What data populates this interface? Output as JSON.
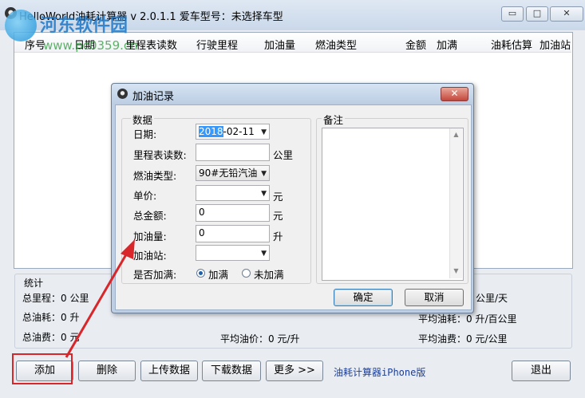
{
  "main": {
    "title": "HelloWorld油耗计算器 v 2.0.1.1   爱车型号：未选择车型",
    "min_glyph": "▭",
    "max_glyph": "□",
    "close_glyph": "✕",
    "watermark_name": "河东软件园",
    "watermark_url": "www.pc0359.cn",
    "columns": [
      "序号",
      "日期",
      "里程表读数",
      "行驶里程",
      "加油量",
      "燃油类型",
      "金额",
      "加满",
      "油耗估算",
      "加油站"
    ]
  },
  "stats": {
    "heading": "统计",
    "total_mileage": "总里程：0 公里",
    "total_fuel": "总油耗：0 升",
    "total_cost": "总油费：0 元",
    "per_day": "公里/天",
    "avg_consumption": "平均油耗：0 升/百公里",
    "avg_price": "平均油价：0 元/升",
    "avg_cost": "平均油费：0 元/公里"
  },
  "buttons": {
    "add": "添加",
    "delete": "删除",
    "upload": "上传数据",
    "download": "下载数据",
    "more": "更多 >>",
    "iphone": "油耗计算器iPhone版",
    "exit": "退出"
  },
  "dialog": {
    "title": "加油记录",
    "close_glyph": "✕",
    "data_group": "数据",
    "notes_group": "备注",
    "date_label": "日期:",
    "date_year": "2018",
    "date_rest": "-02-11",
    "odometer_label": "里程表读数:",
    "odometer_value": "",
    "odometer_unit": "公里",
    "fuel_type_label": "燃油类型:",
    "fuel_type_value": "90#无铅汽油",
    "unit_price_label": "单价:",
    "unit_price_value": "",
    "unit_price_unit": "元",
    "total_label": "总金额:",
    "total_value": "0",
    "total_unit": "元",
    "volume_label": "加油量:",
    "volume_value": "0",
    "volume_unit": "升",
    "station_label": "加油站:",
    "station_value": "",
    "full_label": "是否加满:",
    "full_yes": "加满",
    "full_no": "未加满",
    "notes_value": "",
    "ok": "确定",
    "cancel": "取消"
  }
}
